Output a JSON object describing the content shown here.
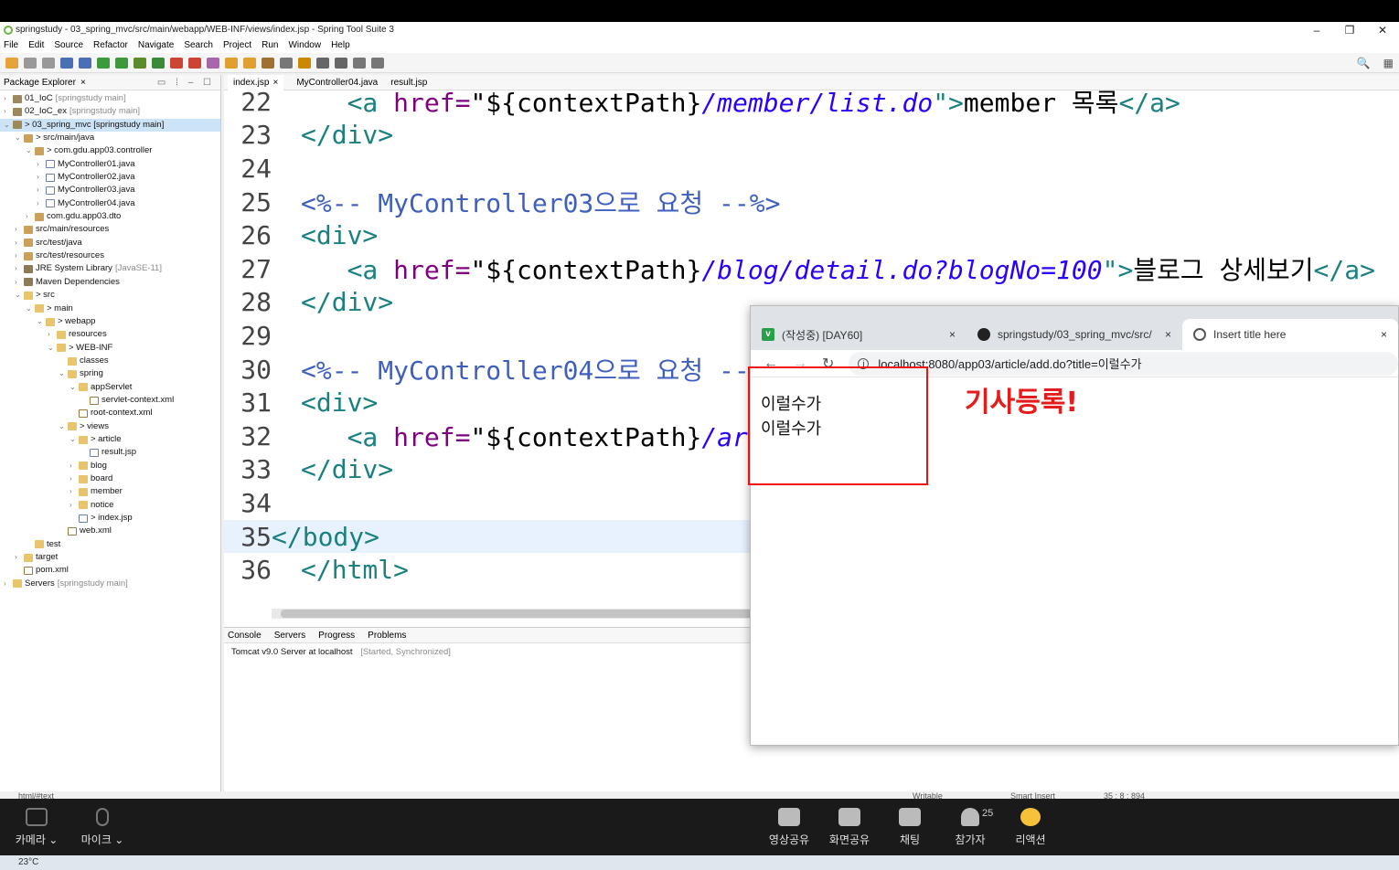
{
  "window": {
    "title": "springstudy - 03_spring_mvc/src/main/webapp/WEB-INF/views/index.jsp - Spring Tool Suite 3",
    "controls": [
      "–",
      "❐",
      "✕"
    ]
  },
  "menu": [
    "File",
    "Edit",
    "Source",
    "Refactor",
    "Navigate",
    "Search",
    "Project",
    "Run",
    "Window",
    "Help"
  ],
  "package_explorer": {
    "tab": "Package Explorer",
    "items": [
      {
        "label": "01_IoC",
        "dim": "[springstudy main]",
        "indent": 0,
        "arrow": "›",
        "icon": "proj"
      },
      {
        "label": "02_IoC_ex",
        "dim": "[springstudy main]",
        "indent": 0,
        "arrow": "›",
        "icon": "proj"
      },
      {
        "label": "> 03_spring_mvc [springstudy main]",
        "dim": "",
        "indent": 0,
        "arrow": "⌄",
        "icon": "proj",
        "selected": true
      },
      {
        "label": "> src/main/java",
        "dim": "",
        "indent": 1,
        "arrow": "⌄",
        "icon": "pkg"
      },
      {
        "label": "> com.gdu.app03.controller",
        "dim": "",
        "indent": 2,
        "arrow": "⌄",
        "icon": "pkg"
      },
      {
        "label": "MyController01.java",
        "dim": "",
        "indent": 3,
        "arrow": "›",
        "icon": "java"
      },
      {
        "label": "MyController02.java",
        "dim": "",
        "indent": 3,
        "arrow": "›",
        "icon": "java"
      },
      {
        "label": "MyController03.java",
        "dim": "",
        "indent": 3,
        "arrow": "›",
        "icon": "java"
      },
      {
        "label": "MyController04.java",
        "dim": "",
        "indent": 3,
        "arrow": "›",
        "icon": "java"
      },
      {
        "label": "com.gdu.app03.dto",
        "dim": "",
        "indent": 2,
        "arrow": "›",
        "icon": "pkg"
      },
      {
        "label": "src/main/resources",
        "dim": "",
        "indent": 1,
        "arrow": "›",
        "icon": "pkg"
      },
      {
        "label": "src/test/java",
        "dim": "",
        "indent": 1,
        "arrow": "›",
        "icon": "pkg"
      },
      {
        "label": "src/test/resources",
        "dim": "",
        "indent": 1,
        "arrow": "›",
        "icon": "pkg"
      },
      {
        "label": "JRE System Library",
        "dim": "[JavaSE-11]",
        "indent": 1,
        "arrow": "›",
        "icon": "lib"
      },
      {
        "label": "Maven Dependencies",
        "dim": "",
        "indent": 1,
        "arrow": "›",
        "icon": "lib"
      },
      {
        "label": "> src",
        "dim": "",
        "indent": 1,
        "arrow": "⌄",
        "icon": "folder"
      },
      {
        "label": "> main",
        "dim": "",
        "indent": 2,
        "arrow": "⌄",
        "icon": "folder"
      },
      {
        "label": "> webapp",
        "dim": "",
        "indent": 3,
        "arrow": "⌄",
        "icon": "folder"
      },
      {
        "label": "resources",
        "dim": "",
        "indent": 4,
        "arrow": "›",
        "icon": "folder"
      },
      {
        "label": "> WEB-INF",
        "dim": "",
        "indent": 4,
        "arrow": "⌄",
        "icon": "folder"
      },
      {
        "label": "classes",
        "dim": "",
        "indent": 5,
        "arrow": "",
        "icon": "folder"
      },
      {
        "label": "spring",
        "dim": "",
        "indent": 5,
        "arrow": "⌄",
        "icon": "folder"
      },
      {
        "label": "appServlet",
        "dim": "",
        "indent": 6,
        "arrow": "⌄",
        "icon": "folder"
      },
      {
        "label": "servlet-context.xml",
        "dim": "",
        "indent": 7,
        "arrow": "",
        "icon": "xml"
      },
      {
        "label": "root-context.xml",
        "dim": "",
        "indent": 6,
        "arrow": "",
        "icon": "xml"
      },
      {
        "label": "> views",
        "dim": "",
        "indent": 5,
        "arrow": "⌄",
        "icon": "folder"
      },
      {
        "label": "> article",
        "dim": "",
        "indent": 6,
        "arrow": "⌄",
        "icon": "folder"
      },
      {
        "label": "result.jsp",
        "dim": "",
        "indent": 7,
        "arrow": "",
        "icon": "java"
      },
      {
        "label": "blog",
        "dim": "",
        "indent": 6,
        "arrow": "›",
        "icon": "folder"
      },
      {
        "label": "board",
        "dim": "",
        "indent": 6,
        "arrow": "›",
        "icon": "folder"
      },
      {
        "label": "member",
        "dim": "",
        "indent": 6,
        "arrow": "›",
        "icon": "folder"
      },
      {
        "label": "notice",
        "dim": "",
        "indent": 6,
        "arrow": "›",
        "icon": "folder"
      },
      {
        "label": "> index.jsp",
        "dim": "",
        "indent": 6,
        "arrow": "",
        "icon": "java"
      },
      {
        "label": "web.xml",
        "dim": "",
        "indent": 5,
        "arrow": "",
        "icon": "xml"
      },
      {
        "label": "test",
        "dim": "",
        "indent": 2,
        "arrow": "",
        "icon": "folder"
      },
      {
        "label": "target",
        "dim": "",
        "indent": 1,
        "arrow": "›",
        "icon": "folder"
      },
      {
        "label": "pom.xml",
        "dim": "",
        "indent": 1,
        "arrow": "",
        "icon": "xml"
      },
      {
        "label": "Servers",
        "dim": "[springstudy main]",
        "indent": 0,
        "arrow": "›",
        "icon": "folder"
      }
    ]
  },
  "editor": {
    "tabs": [
      "index.jsp",
      "MyController04.java",
      "result.jsp"
    ],
    "lines": [
      {
        "num": "22",
        "segs": [
          [
            "   ",
            "plain"
          ],
          [
            "<a ",
            "tag"
          ],
          [
            "href=",
            "attr"
          ],
          [
            "\"${contextPath}",
            "plain"
          ],
          [
            "/member/list.do",
            "str"
          ],
          [
            "\">",
            "tag"
          ],
          [
            "member 목록",
            "plain"
          ],
          [
            "</a>",
            "tag"
          ]
        ]
      },
      {
        "num": "23",
        "segs": [
          [
            "</div>",
            "tag"
          ]
        ]
      },
      {
        "num": "24",
        "segs": []
      },
      {
        "num": "25",
        "segs": [
          [
            "<%-- MyController03으로 요청 --%>",
            "cmt"
          ]
        ]
      },
      {
        "num": "26",
        "segs": [
          [
            "<div>",
            "tag"
          ]
        ]
      },
      {
        "num": "27",
        "segs": [
          [
            "   ",
            "plain"
          ],
          [
            "<a ",
            "tag"
          ],
          [
            "href=",
            "attr"
          ],
          [
            "\"${contextPath}",
            "plain"
          ],
          [
            "/blog/detail.do?blogNo=100",
            "str"
          ],
          [
            "\">",
            "tag"
          ],
          [
            "블로그 상세보기",
            "plain"
          ],
          [
            "</a>",
            "tag"
          ]
        ]
      },
      {
        "num": "28",
        "segs": [
          [
            "</div>",
            "tag"
          ]
        ]
      },
      {
        "num": "29",
        "segs": []
      },
      {
        "num": "30",
        "segs": [
          [
            "<%-- MyController04으로 요청 --%>",
            "cmt"
          ]
        ]
      },
      {
        "num": "31",
        "segs": [
          [
            "<div>",
            "tag"
          ]
        ]
      },
      {
        "num": "32",
        "segs": [
          [
            "   ",
            "plain"
          ],
          [
            "<a ",
            "tag"
          ],
          [
            "href=",
            "attr"
          ],
          [
            "\"${contextPath}",
            "plain"
          ],
          [
            "/article/add.do?title=이럴수가",
            "str"
          ],
          [
            "\">",
            "tag"
          ],
          [
            "기사등록",
            "plain"
          ],
          [
            "</a>",
            "tag"
          ]
        ]
      },
      {
        "num": "33",
        "segs": [
          [
            "</div>",
            "tag"
          ]
        ]
      },
      {
        "num": "34",
        "segs": []
      },
      {
        "num": "35",
        "segs": [
          [
            "</body>",
            "tag"
          ]
        ],
        "current": true
      },
      {
        "num": "36",
        "segs": [
          [
            "</html>",
            "tag"
          ]
        ]
      }
    ]
  },
  "console": {
    "tabs": [
      "Console",
      "Servers",
      "Progress",
      "Problems"
    ],
    "server": "Tomcat v9.0 Server at localhost",
    "server_state": "[Started, Synchronized]"
  },
  "statusbar": {
    "left": "html/#text",
    "writable": "Writable",
    "insert": "Smart Insert",
    "pos": "35 : 8 : 894"
  },
  "browser": {
    "tabs": [
      {
        "label": "(작성중) [DAY60]",
        "icon": "v"
      },
      {
        "label": "springstudy/03_spring_mvc/src/",
        "icon": "gh"
      },
      {
        "label": "Insert title here",
        "icon": "globe"
      }
    ],
    "url": "localhost:8080/app03/article/add.do?title=이럴수가",
    "content": [
      "이럴수가",
      "이럴수가"
    ],
    "annotation": "기사등록!"
  },
  "zoom": {
    "camera": "카메라 ⌄",
    "mic": "마이크 ⌄",
    "buttons": [
      "영상공유",
      "화면공유",
      "채팅",
      "참가자",
      "리액션"
    ],
    "participants": "25"
  },
  "taskbar": {
    "temp": "23°C"
  }
}
